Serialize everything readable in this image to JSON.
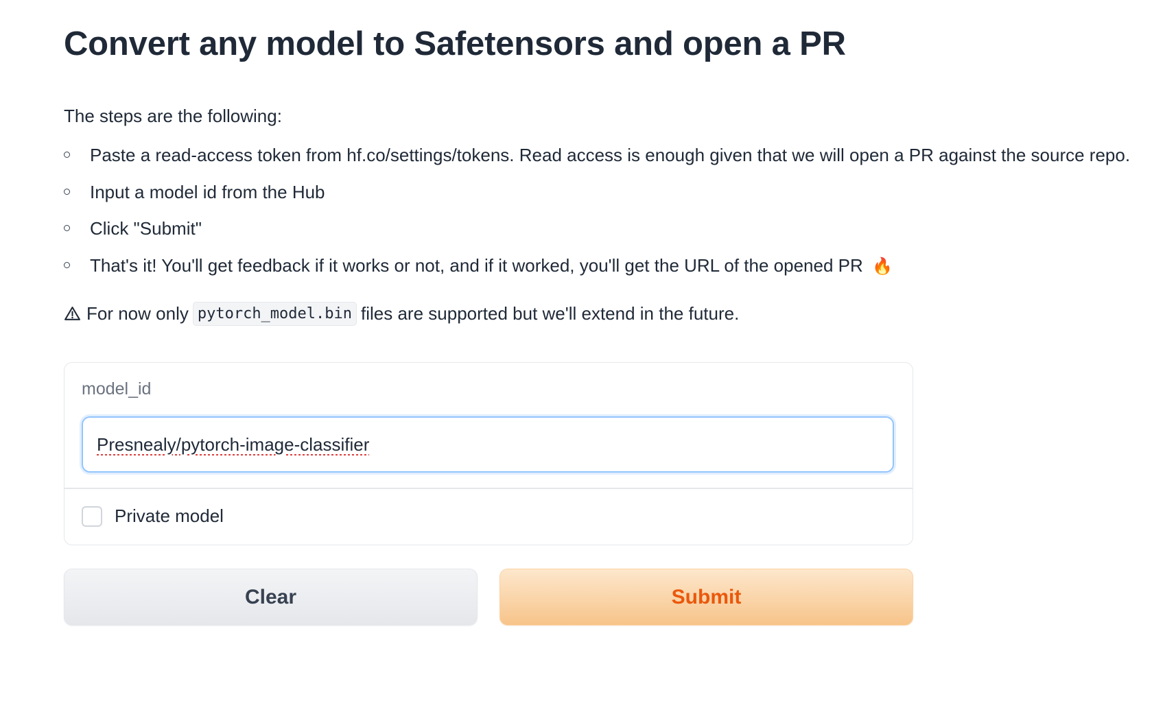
{
  "header": {
    "title": "Convert any model to Safetensors and open a PR"
  },
  "description": {
    "intro": "The steps are the following:",
    "steps": [
      "Paste a read-access token from hf.co/settings/tokens. Read access is enough given that we will open a PR against the source repo.",
      "Input a model id from the Hub",
      "Click \"Submit\"",
      "That's it! You'll get feedback if it works or not, and if it worked, you'll get the URL of the opened PR"
    ],
    "steps_last_emoji": "🔥",
    "warning": {
      "icon": "warning-icon",
      "before": "For now only",
      "code": "pytorch_model.bin",
      "after": "files are supported but we'll extend in the future."
    }
  },
  "form": {
    "model_id_label": "model_id",
    "model_id_value": "Presnealy/pytorch-image-classifier",
    "private_model_label": "Private model",
    "private_model_checked": false
  },
  "actions": {
    "clear_label": "Clear",
    "submit_label": "Submit"
  },
  "colors": {
    "submit_text": "#ea580c",
    "submit_bg": "#f7c48a",
    "input_focus_border": "#93c5fd"
  }
}
